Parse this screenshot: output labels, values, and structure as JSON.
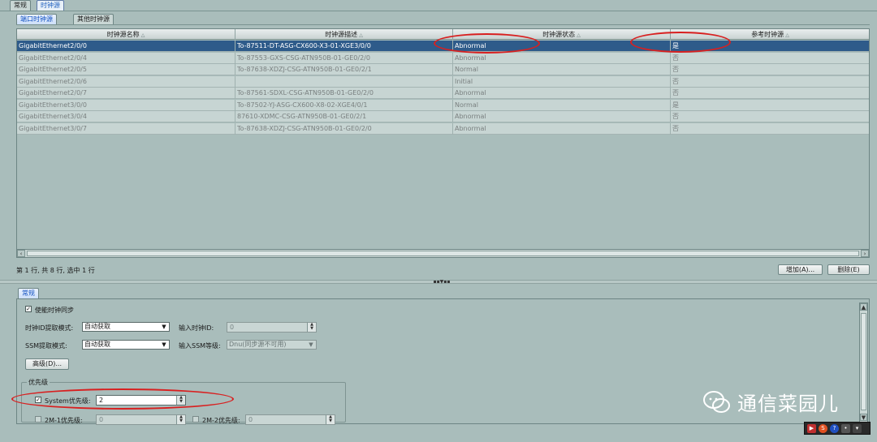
{
  "top_tabs": [
    "常规",
    "时钟源"
  ],
  "sub_tabs": [
    "端口时钟源",
    "其他时钟源"
  ],
  "table": {
    "columns": [
      "时钟源名称",
      "时钟源描述",
      "时钟源状态",
      "参考时钟源"
    ],
    "rows": [
      [
        "GigabitEthernet2/0/0",
        "To-87511-DT-ASG-CX600-X3-01-XGE3/0/0",
        "Abnormal",
        "是"
      ],
      [
        "GigabitEthernet2/0/4",
        "To-87553-GXS-CSG-ATN950B-01-GE0/2/0",
        "Abnormal",
        "否"
      ],
      [
        "GigabitEthernet2/0/5",
        "To-87638-XDZJ-CSG-ATN950B-01-GE0/2/1",
        "Normal",
        "否"
      ],
      [
        "GigabitEthernet2/0/6",
        "",
        "Initial",
        "否"
      ],
      [
        "GigabitEthernet2/0/7",
        "To-87561-SDXL-CSG-ATN950B-01-GE0/2/0",
        "Abnormal",
        "否"
      ],
      [
        "GigabitEthernet3/0/0",
        "To-87502-YJ-ASG-CX600-X8-02-XGE4/0/1",
        "Normal",
        "是"
      ],
      [
        "GigabitEthernet3/0/4",
        "87610-XDMC-CSG-ATN950B-01-GE0/2/1",
        "Abnormal",
        "否"
      ],
      [
        "GigabitEthernet3/0/7",
        "To-87638-XDZJ-CSG-ATN950B-01-GE0/2/0",
        "Abnormal",
        "否"
      ]
    ],
    "selected_row": 0
  },
  "status_text": "第 1 行, 共 8 行, 选中 1 行",
  "buttons": {
    "add": "增加(A)...",
    "delete": "删除(E)",
    "advanced": "高级(D)..."
  },
  "bottom_tab": "常规",
  "form": {
    "enable_sync": "使能时钟同步",
    "clock_id_mode_label": "时钟ID提取模式:",
    "clock_id_mode_value": "自动获取",
    "input_clock_id_label": "输入时钟ID:",
    "input_clock_id_value": "0",
    "ssm_mode_label": "SSM提取模式:",
    "ssm_mode_value": "自动获取",
    "input_ssm_label": "输入SSM等级:",
    "input_ssm_value": "Dnu(同步源不可用)",
    "priority_group": "优先级",
    "system_priority_label": "System优先级:",
    "system_priority_value": "2",
    "m1_priority_label": "2M-1优先级:",
    "m1_priority_value": "0",
    "m2_priority_label": "2M-2优先级:",
    "m2_priority_value": "0"
  },
  "watermark": "通信菜园儿",
  "colors": {
    "selection": "#2e5b8a",
    "annotation": "#d82020",
    "background": "#a9bdbb"
  }
}
